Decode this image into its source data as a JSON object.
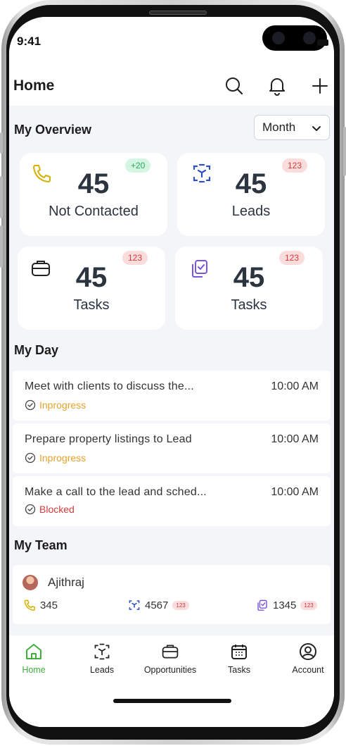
{
  "status": {
    "time": "9:41"
  },
  "header": {
    "title": "Home"
  },
  "overview": {
    "title": "My Overview",
    "period": "Month",
    "cards": [
      {
        "value": "45",
        "label": "Not Contacted",
        "badge": "+20",
        "icon": "phone-icon"
      },
      {
        "value": "45",
        "label": "Leads",
        "badge": "123",
        "icon": "leads-icon"
      },
      {
        "value": "45",
        "label": "Tasks",
        "badge": "123",
        "icon": "briefcase-icon"
      },
      {
        "value": "45",
        "label": "Tasks",
        "badge": "123",
        "icon": "clipboard-icon"
      }
    ]
  },
  "my_day": {
    "title": "My Day",
    "tasks": [
      {
        "title": "Meet with clients to discuss the...",
        "time": "10:00 AM",
        "status": "Inprogress"
      },
      {
        "title": "Prepare property listings to Lead",
        "time": "10:00 AM",
        "status": "Inprogress"
      },
      {
        "title": "Make a call to the lead and sched...",
        "time": "10:00 AM",
        "status": "Blocked"
      }
    ]
  },
  "my_team": {
    "title": "My Team",
    "members": [
      {
        "name": "Ajithraj",
        "calls": "345",
        "leads": "4567",
        "leads_badge": "123",
        "tasks": "1345",
        "tasks_badge": "123"
      }
    ]
  },
  "tabs": [
    {
      "label": "Home",
      "icon": "home-icon",
      "active": true
    },
    {
      "label": "Leads",
      "icon": "leads-icon"
    },
    {
      "label": "Opportunities",
      "icon": "briefcase-icon"
    },
    {
      "label": "Tasks",
      "icon": "calendar-icon"
    },
    {
      "label": "Account",
      "icon": "account-icon"
    }
  ],
  "colors": {
    "accent_green": "#3fae3f",
    "inprogress": "#e6a22c",
    "blocked": "#d23a3a",
    "phone_yellow": "#d4b000",
    "leads_blue": "#2f4fc4",
    "clipboard_purple": "#7a55e0"
  }
}
